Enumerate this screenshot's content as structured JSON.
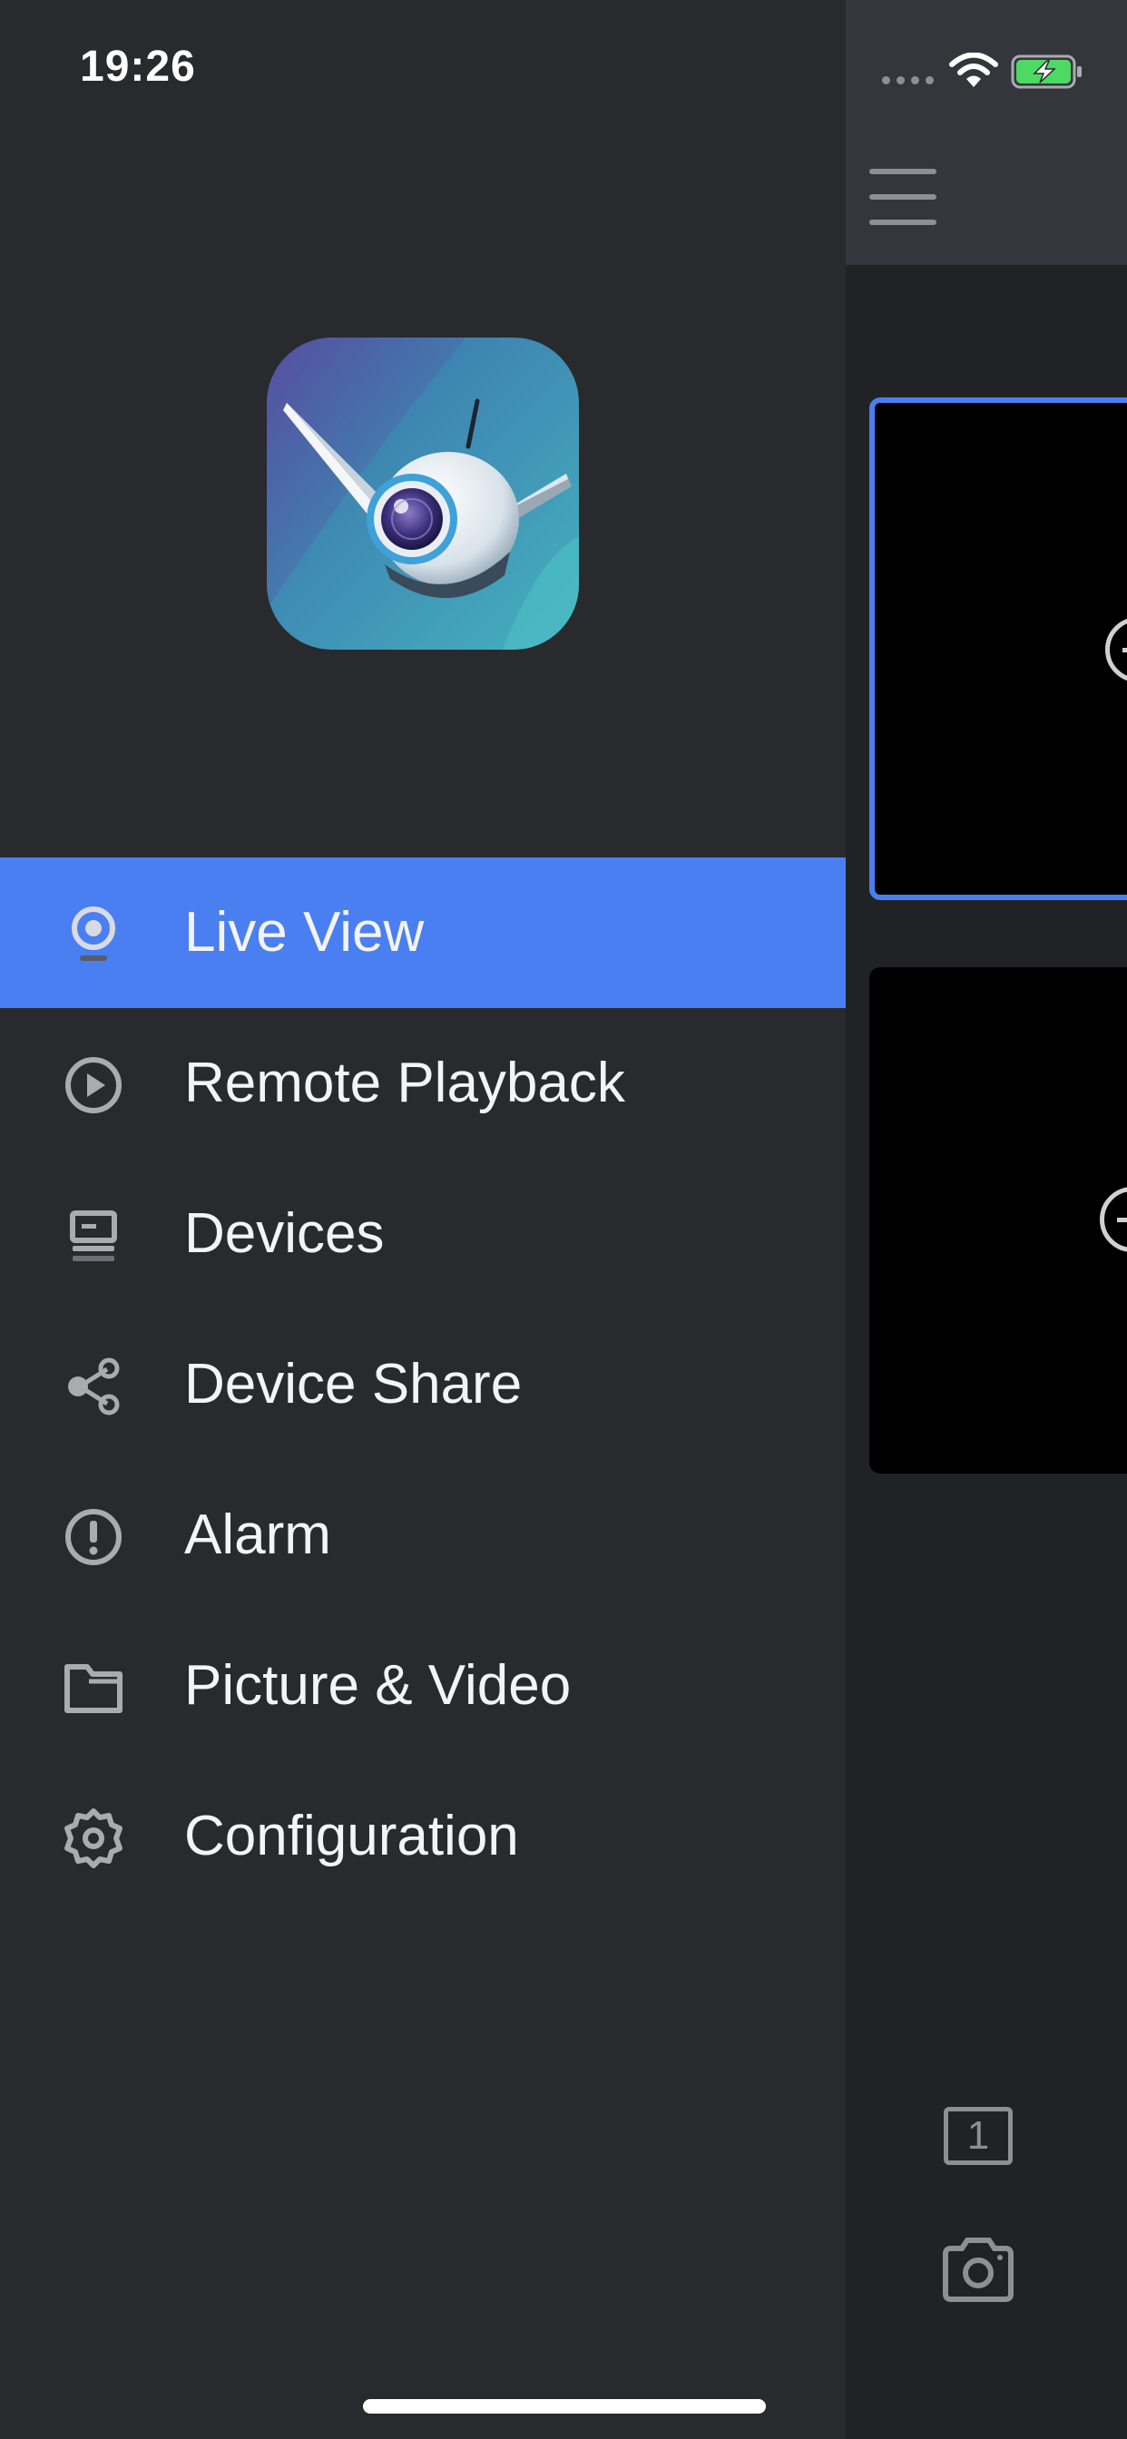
{
  "status_bar": {
    "time": "19:26"
  },
  "drawer": {
    "logo_icon": "robot-camera-app-logo",
    "active_color": "#4a7ff2",
    "menu": [
      {
        "label": "Live View",
        "icon": "webcam-icon",
        "active": true
      },
      {
        "label": "Remote Playback",
        "icon": "play-circle-icon",
        "active": false
      },
      {
        "label": "Devices",
        "icon": "device-recorder-icon",
        "active": false
      },
      {
        "label": "Device Share",
        "icon": "share-icon",
        "active": false
      },
      {
        "label": "Alarm",
        "icon": "alert-circle-icon",
        "active": false
      },
      {
        "label": "Picture & Video",
        "icon": "folder-icon",
        "active": false
      },
      {
        "label": "Configuration",
        "icon": "gear-icon",
        "active": false
      }
    ]
  },
  "background_view": {
    "selected_tile_color": "#4a7ef0",
    "split_layout_label": "1"
  }
}
